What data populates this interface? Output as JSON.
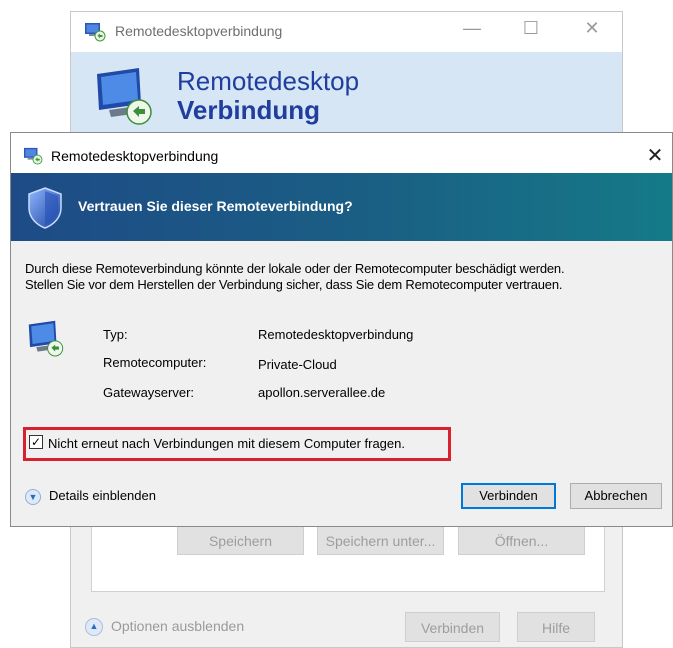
{
  "background_window": {
    "title": "Remotedesktopverbindung",
    "banner_line1": "Remotedesktop",
    "banner_line2": "Verbindung",
    "minimize_glyph": "—",
    "maximize_glyph": "☐",
    "close_glyph": "✕",
    "buttons": {
      "save": "Speichern",
      "save_as": "Speichern unter...",
      "open": "Öffnen...",
      "connect": "Verbinden",
      "help": "Hilfe"
    },
    "options_label": "Optionen ausblenden"
  },
  "dialog": {
    "title": "Remotedesktopverbindung",
    "close_glyph": "✕",
    "heading": "Vertrauen Sie dieser Remoteverbindung?",
    "description_line1": "Durch diese Remoteverbindung könnte der lokale oder der Remotecomputer beschädigt werden.",
    "description_line2": "Stellen Sie vor dem Herstellen der Verbindung sicher, dass Sie dem Remotecomputer vertrauen.",
    "info": {
      "type_label": "Typ:",
      "type_value": "Remotedesktopverbindung",
      "remote_label": "Remotecomputer:",
      "remote_value": "Private-Cloud",
      "gateway_label": "Gatewayserver:",
      "gateway_value": "apollon.serverallee.de"
    },
    "checkbox": {
      "label": "Nicht erneut nach Verbindungen mit diesem Computer fragen.",
      "checked": true,
      "check_glyph": "✓"
    },
    "details_label": "Details einblenden",
    "connect_button": "Verbinden",
    "cancel_button": "Abbrechen"
  },
  "colors": {
    "header_gradient_start": "#1e4b86",
    "header_gradient_end": "#157a88",
    "highlight_border": "#d9202d",
    "primary_button_border": "#0078d7"
  },
  "icons": {
    "app": "remote-desktop-icon",
    "shield": "shield-icon",
    "chevron": "chevron-down-icon"
  }
}
